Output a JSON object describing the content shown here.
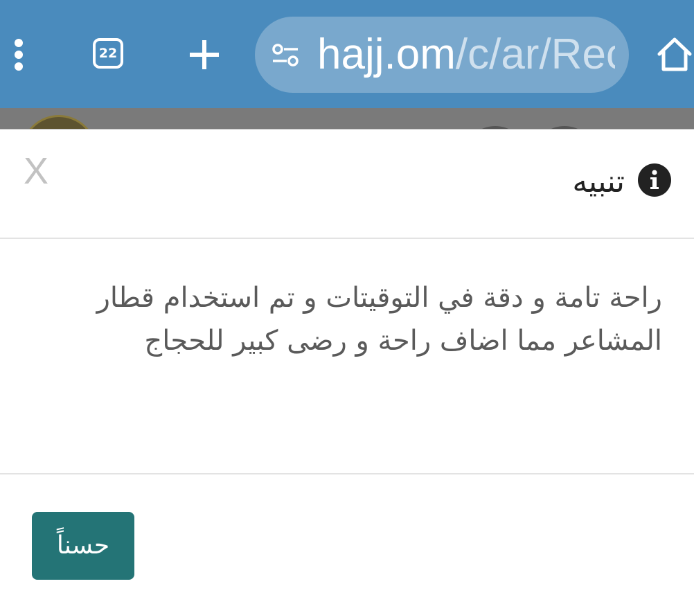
{
  "browser": {
    "tab_count": "22",
    "url_host": "hajj.om",
    "url_path": "/c/ar/Rec",
    "icons": {
      "menu": "more-vertical-icon",
      "tabs": "tab-switcher-icon",
      "new_tab": "plus-icon",
      "site_settings": "site-settings-icon",
      "home": "home-icon"
    },
    "colors": {
      "toolbar": "#4a8bbd",
      "url_bar": "#79a8cd"
    }
  },
  "dialog": {
    "close_label": "X",
    "title": "تنبيه",
    "title_icon": "info-icon",
    "message": "راحة تامة و دقة في التوقيتات و تم استخدام قطار المشاعر مما اضاف راحة و رضى كبير للحجاج",
    "ok_label": "حسناً",
    "colors": {
      "ok_button": "#247476"
    }
  }
}
